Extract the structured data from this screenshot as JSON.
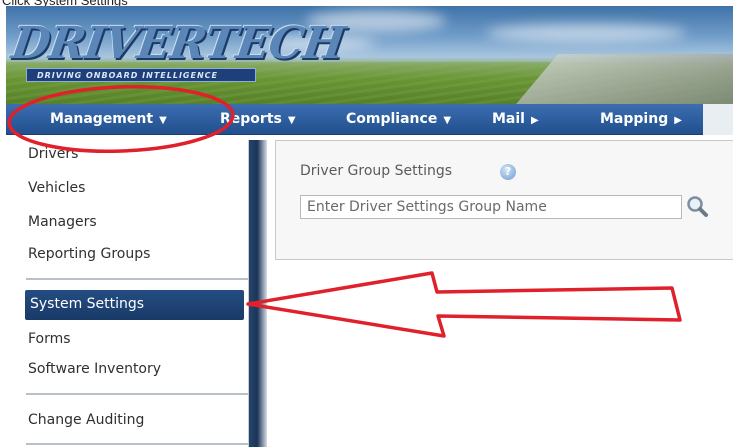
{
  "caption": "Click System Settings",
  "brand": {
    "name": "DRIVERTECH",
    "tagline": "DRIVING ONBOARD INTELLIGENCE"
  },
  "nav": {
    "items": [
      {
        "label": "Management",
        "arrow": "▼"
      },
      {
        "label": "Reports",
        "arrow": "▼"
      },
      {
        "label": "Compliance",
        "arrow": "▼"
      },
      {
        "label": "Mail",
        "arrow": "▶"
      },
      {
        "label": "Mapping",
        "arrow": "▶"
      }
    ]
  },
  "dropdown": {
    "items": [
      "Drivers",
      "Vehicles",
      "Managers",
      "Reporting Groups",
      "System Settings",
      "Forms",
      "Software Inventory",
      "Change Auditing"
    ],
    "selected": "System Settings"
  },
  "panel": {
    "title": "Driver Group Settings",
    "help_icon": "help-icon",
    "search_placeholder": "Enter Driver Settings Group Name",
    "search_value": "",
    "search_icon": "magnifier-icon"
  },
  "colors": {
    "nav_blue": "#22508e",
    "selected_bg": "#183a67",
    "annotation_red": "#e0202a"
  }
}
